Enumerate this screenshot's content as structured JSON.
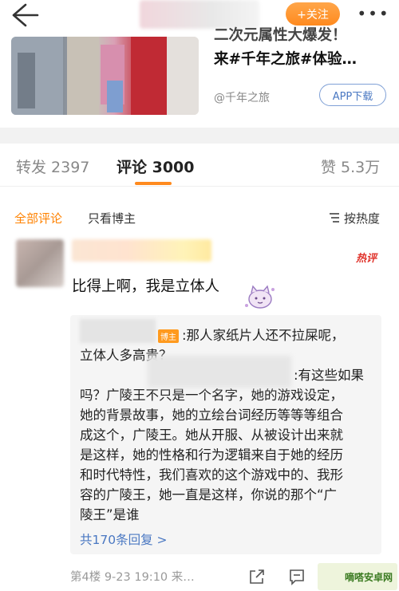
{
  "topbar": {
    "follow_label": "+关注",
    "more_label": "•••"
  },
  "card": {
    "title_line1": "二次元属性大爆发！",
    "title_line2": "来#千年之旅#体验…",
    "source": "@千年之旅",
    "app_button": "APP下载"
  },
  "tabs": {
    "repost": "转发 2397",
    "comment": "评论 3000",
    "like": "赞 5.3万"
  },
  "filters": {
    "all": "全部评论",
    "blogger_only": "只看博主",
    "sort": "按热度"
  },
  "comment": {
    "hot_tag": "热评",
    "text": "比得上啊，我是立体人"
  },
  "reply": {
    "blogger_tag": "博主",
    "line1": ":那人家纸片人还不拉屎呢，",
    "line2": "立体人多高贵？",
    "line3": ":有这些如果",
    "line4": "吗？广陵王不只是一个名字，她的游戏设定，",
    "line5": "她的背景故事，她的立绘台词经历等等等组合",
    "line6": "成这个，广陵王。她从开服、从被设计出来就",
    "line7": "是这样，她的性格和行为逻辑来自于她的经历",
    "line8": "和时代特性，我们喜欢的这个游戏中的、我形",
    "line9": "容的广陵王，她一直是这样，你说的那个“广",
    "line10": "陵王”是谁",
    "more": "共170条回复 >"
  },
  "meta": {
    "floor_time": "第4楼 9-23 19:10 来…"
  },
  "watermark": "嘀嗒安卓网",
  "colors": {
    "accent": "#ff8200",
    "link": "#4a78c2",
    "hot": "#e0342c"
  }
}
